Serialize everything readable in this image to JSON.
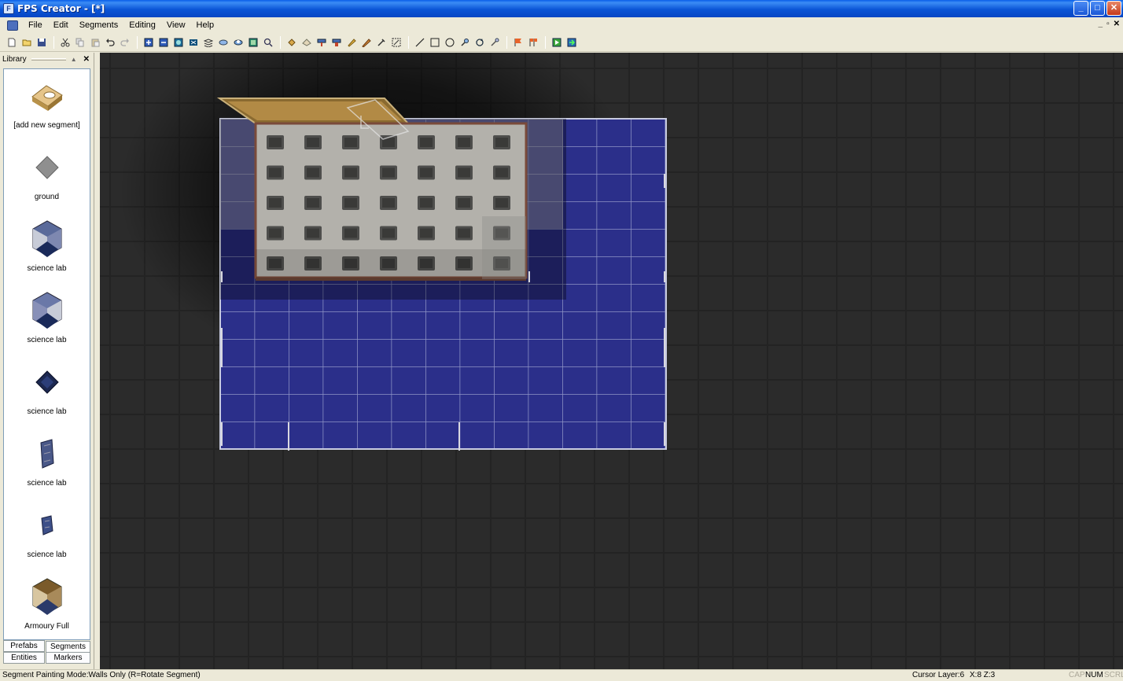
{
  "window": {
    "title": "FPS Creator - [*]"
  },
  "menu": [
    "File",
    "Edit",
    "Segments",
    "Editing",
    "View",
    "Help"
  ],
  "library": {
    "title": "Library",
    "items": [
      {
        "label": "[add new segment]",
        "icon": "add-segment-icon"
      },
      {
        "label": "ground",
        "icon": "ground-tile-icon"
      },
      {
        "label": "science lab",
        "icon": "corner-wall-icon"
      },
      {
        "label": "science lab",
        "icon": "corner-wall-icon"
      },
      {
        "label": "science lab",
        "icon": "floor-tile-icon"
      },
      {
        "label": "science lab",
        "icon": "wall-panel-icon"
      },
      {
        "label": "science lab",
        "icon": "small-panel-icon"
      },
      {
        "label": "Armoury Full",
        "icon": "armoury-icon"
      }
    ],
    "tabs": [
      "Prefabs",
      "Segments",
      "Entities",
      "Markers"
    ]
  },
  "status": {
    "message": "Segment Painting Mode:Walls Only (R=Rotate Segment)",
    "cursor_layer": "Cursor Layer:6",
    "coords": "X:8  Z:3",
    "cap": "CAP",
    "num": "NUM",
    "scrl": "SCRL"
  },
  "colors": {
    "floor": "#2b2f8a",
    "ceiling": "#b8b6b0",
    "viewport": "#2b2b2b"
  }
}
